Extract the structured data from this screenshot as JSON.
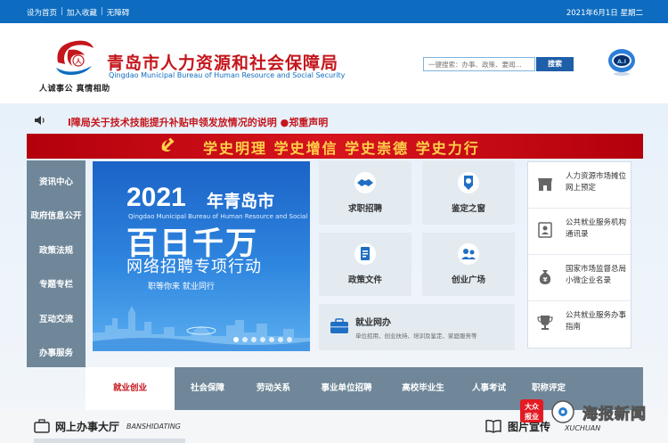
{
  "topbar": {
    "links": [
      "设为首页",
      "加入收藏",
      "无障碍"
    ],
    "separator": "|",
    "date": "2021年6月1日 星期二"
  },
  "header": {
    "slogan": "人诚事公 真情相助",
    "org_name": "青岛市人力资源和社会保障局",
    "org_name_en": "Qingdao Municipal Bureau of Human Resource and Social Security",
    "search_placeholder": "一键搜索：办事、政策、要闻...",
    "search_button": "搜索",
    "assistant_label": "A.I"
  },
  "notice": {
    "text": "l障局关于技术技能提升补贴申领发放情况的说明 ●郑重声明"
  },
  "banner": {
    "slogans": "学史明理 学史增信 学史崇德 学史力行"
  },
  "left_nav": {
    "items": [
      "资讯中心",
      "政府信息公开",
      "政策法规",
      "专题专栏",
      "互动交流",
      "办事服务"
    ]
  },
  "hero": {
    "year": "2021",
    "city": "年青岛市",
    "subtitle_en": "Qingdao Municipal Bureau of Human Resource and Social Security",
    "headline": "百日千万",
    "campaign": "网络招聘专项行动",
    "tagline": "职等你来   就业同行",
    "slide_count": 7,
    "active_slide": 0
  },
  "tiles": [
    {
      "label": "求职招聘",
      "icon": "handshake-icon"
    },
    {
      "label": "鉴定之窗",
      "icon": "certificate-badge-icon"
    },
    {
      "label": "政策文件",
      "icon": "document-icon"
    },
    {
      "label": "创业广场",
      "icon": "person-group-icon"
    }
  ],
  "wide_tile": {
    "title": "就业网办",
    "desc": "单位招用、创业扶持、培训及鉴定、家庭服务等",
    "icon": "briefcase-icon"
  },
  "right_list": [
    {
      "text": "人力资源市场摊位网上预定",
      "icon": "shop-icon"
    },
    {
      "text": "公共就业服务机构通讯录",
      "icon": "contacts-icon"
    },
    {
      "text": "国家市场监督总局小微企业名录",
      "icon": "money-bag-icon"
    },
    {
      "text": "公共就业服务办事指南",
      "icon": "trophy-icon"
    }
  ],
  "tabs": {
    "items": [
      "就业创业",
      "社会保障",
      "劳动关系",
      "事业单位招聘",
      "高校毕业生",
      "人事考试",
      "职称评定"
    ],
    "active": 0
  },
  "bottom": {
    "hall_title": "网上办事大厅",
    "hall_en": "BANSHIDATING",
    "pic_title": "图片宣传",
    "pic_en": "XUCHUAN"
  },
  "watermark": {
    "badge": "报业",
    "name": "海报新闻"
  },
  "colors": {
    "brand_blue": "#0d6cc0",
    "brand_red": "#c4161c",
    "banner_gold": "#ffd24a",
    "nav_gray": "#6f8799"
  }
}
